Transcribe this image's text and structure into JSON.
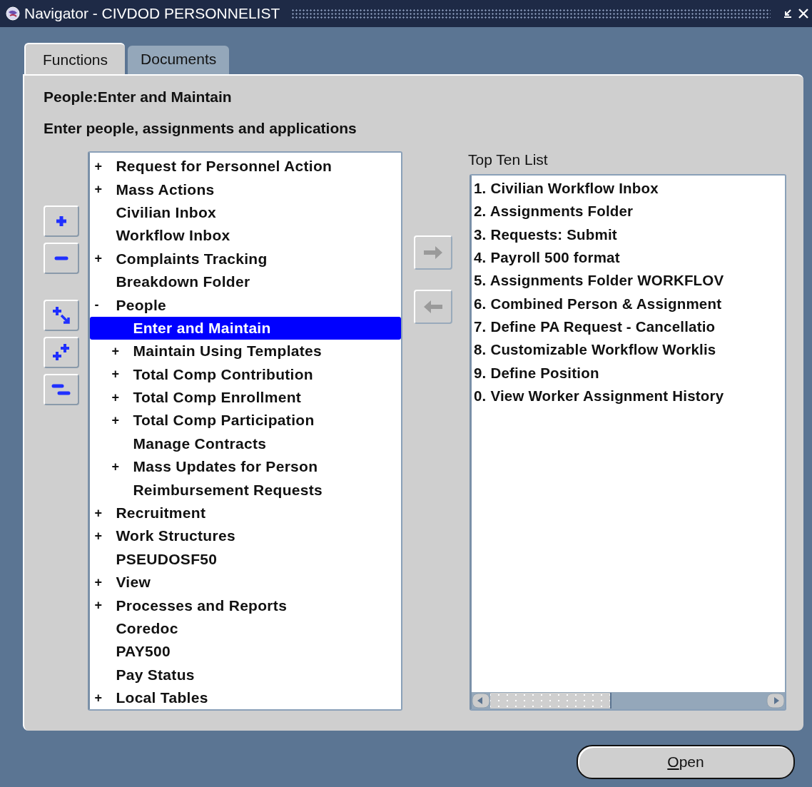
{
  "window": {
    "title": "Navigator - CIVDOD PERSONNELIST"
  },
  "tabs": [
    {
      "label": "Functions",
      "selected": true
    },
    {
      "label": "Documents",
      "selected": false
    }
  ],
  "heading": "People:Enter and Maintain",
  "description": "Enter people, assignments and applications",
  "tree": {
    "items": [
      {
        "marker": "+",
        "label": "Request for Personnel Action",
        "selected": false
      },
      {
        "marker": "+",
        "label": "Mass Actions",
        "selected": false
      },
      {
        "label": "Civilian Inbox",
        "selected": false
      },
      {
        "label": "Workflow Inbox",
        "selected": false
      },
      {
        "marker": "+",
        "label": "Complaints Tracking",
        "selected": false
      },
      {
        "label": "Breakdown Folder",
        "selected": false
      },
      {
        "marker": "-",
        "label": "People",
        "selected": false,
        "children": [
          {
            "label": "Enter and Maintain",
            "selected": true
          },
          {
            "marker": "+",
            "label": "Maintain Using Templates",
            "selected": false
          },
          {
            "marker": "+",
            "label": "Total Comp Contribution",
            "selected": false
          },
          {
            "marker": "+",
            "label": "Total Comp Enrollment",
            "selected": false
          },
          {
            "marker": "+",
            "label": "Total Comp Participation",
            "selected": false
          },
          {
            "label": "Manage Contracts",
            "selected": false
          },
          {
            "marker": "+",
            "label": "Mass Updates for Person",
            "selected": false
          },
          {
            "label": "Reimbursement Requests",
            "selected": false
          }
        ]
      },
      {
        "marker": "+",
        "label": "Recruitment",
        "selected": false
      },
      {
        "marker": "+",
        "label": "Work Structures",
        "selected": false
      },
      {
        "label": "PSEUDOSF50",
        "selected": false
      },
      {
        "marker": "+",
        "label": "View",
        "selected": false
      },
      {
        "marker": "+",
        "label": "Processes and Reports",
        "selected": false
      },
      {
        "label": "Coredoc",
        "selected": false
      },
      {
        "label": "PAY500",
        "selected": false
      },
      {
        "label": "Pay Status",
        "selected": false
      },
      {
        "marker": "+",
        "label": "Local Tables",
        "selected": false
      }
    ]
  },
  "top_ten": {
    "label": "Top Ten List",
    "items": [
      "1. Civilian Workflow Inbox",
      "2. Assignments Folder",
      "3. Requests: Submit",
      "4. Payroll 500 format",
      "5. Assignments Folder WORKFLOV",
      "6. Combined Person & Assignment",
      "7. Define PA Request - Cancellatio",
      "8. Customizable Workflow Worklis",
      "9. Define  Position",
      "0. View Worker Assignment History"
    ]
  },
  "open_button": {
    "label": "Open"
  }
}
